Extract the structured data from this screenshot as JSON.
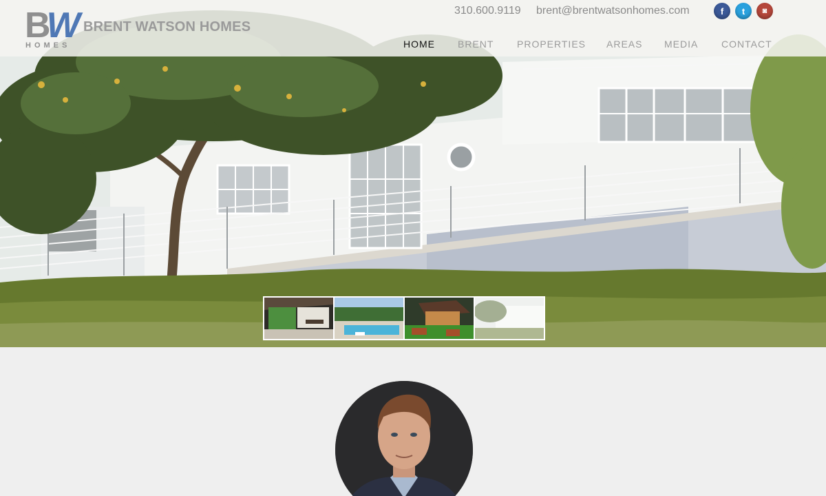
{
  "header": {
    "logo_letters": "BW",
    "logo_b": "B",
    "logo_w": "W",
    "logo_sub": "HOMES",
    "brand": "BRENT WATSON HOMES",
    "phone": "310.600.9119",
    "email": "brent@brentwatsonhomes.com",
    "social": [
      {
        "icon": "facebook-icon",
        "glyph": "f",
        "color": "#3b5998"
      },
      {
        "icon": "twitter-icon",
        "glyph": "t",
        "color": "#2aa1de"
      },
      {
        "icon": "instagram-icon",
        "glyph": "◙",
        "color": "#b5473b"
      }
    ]
  },
  "nav": {
    "items": [
      {
        "label": "HOME",
        "active": true
      },
      {
        "label": "BRENT",
        "active": false
      },
      {
        "label": "PROPERTIES",
        "active": false
      },
      {
        "label": "AREAS",
        "active": false
      },
      {
        "label": "MEDIA",
        "active": false
      },
      {
        "label": "CONTACT",
        "active": false
      }
    ]
  },
  "slideshow": {
    "thumbnails": [
      {
        "subject": "interior-glass-room"
      },
      {
        "subject": "pool-garden"
      },
      {
        "subject": "evening-patio"
      },
      {
        "subject": "white-house-garden"
      }
    ],
    "active_index": 3
  },
  "colors": {
    "brand_blue": "#4f78b5",
    "brand_gray": "#8f8f8f",
    "page_background": "#efefef"
  }
}
